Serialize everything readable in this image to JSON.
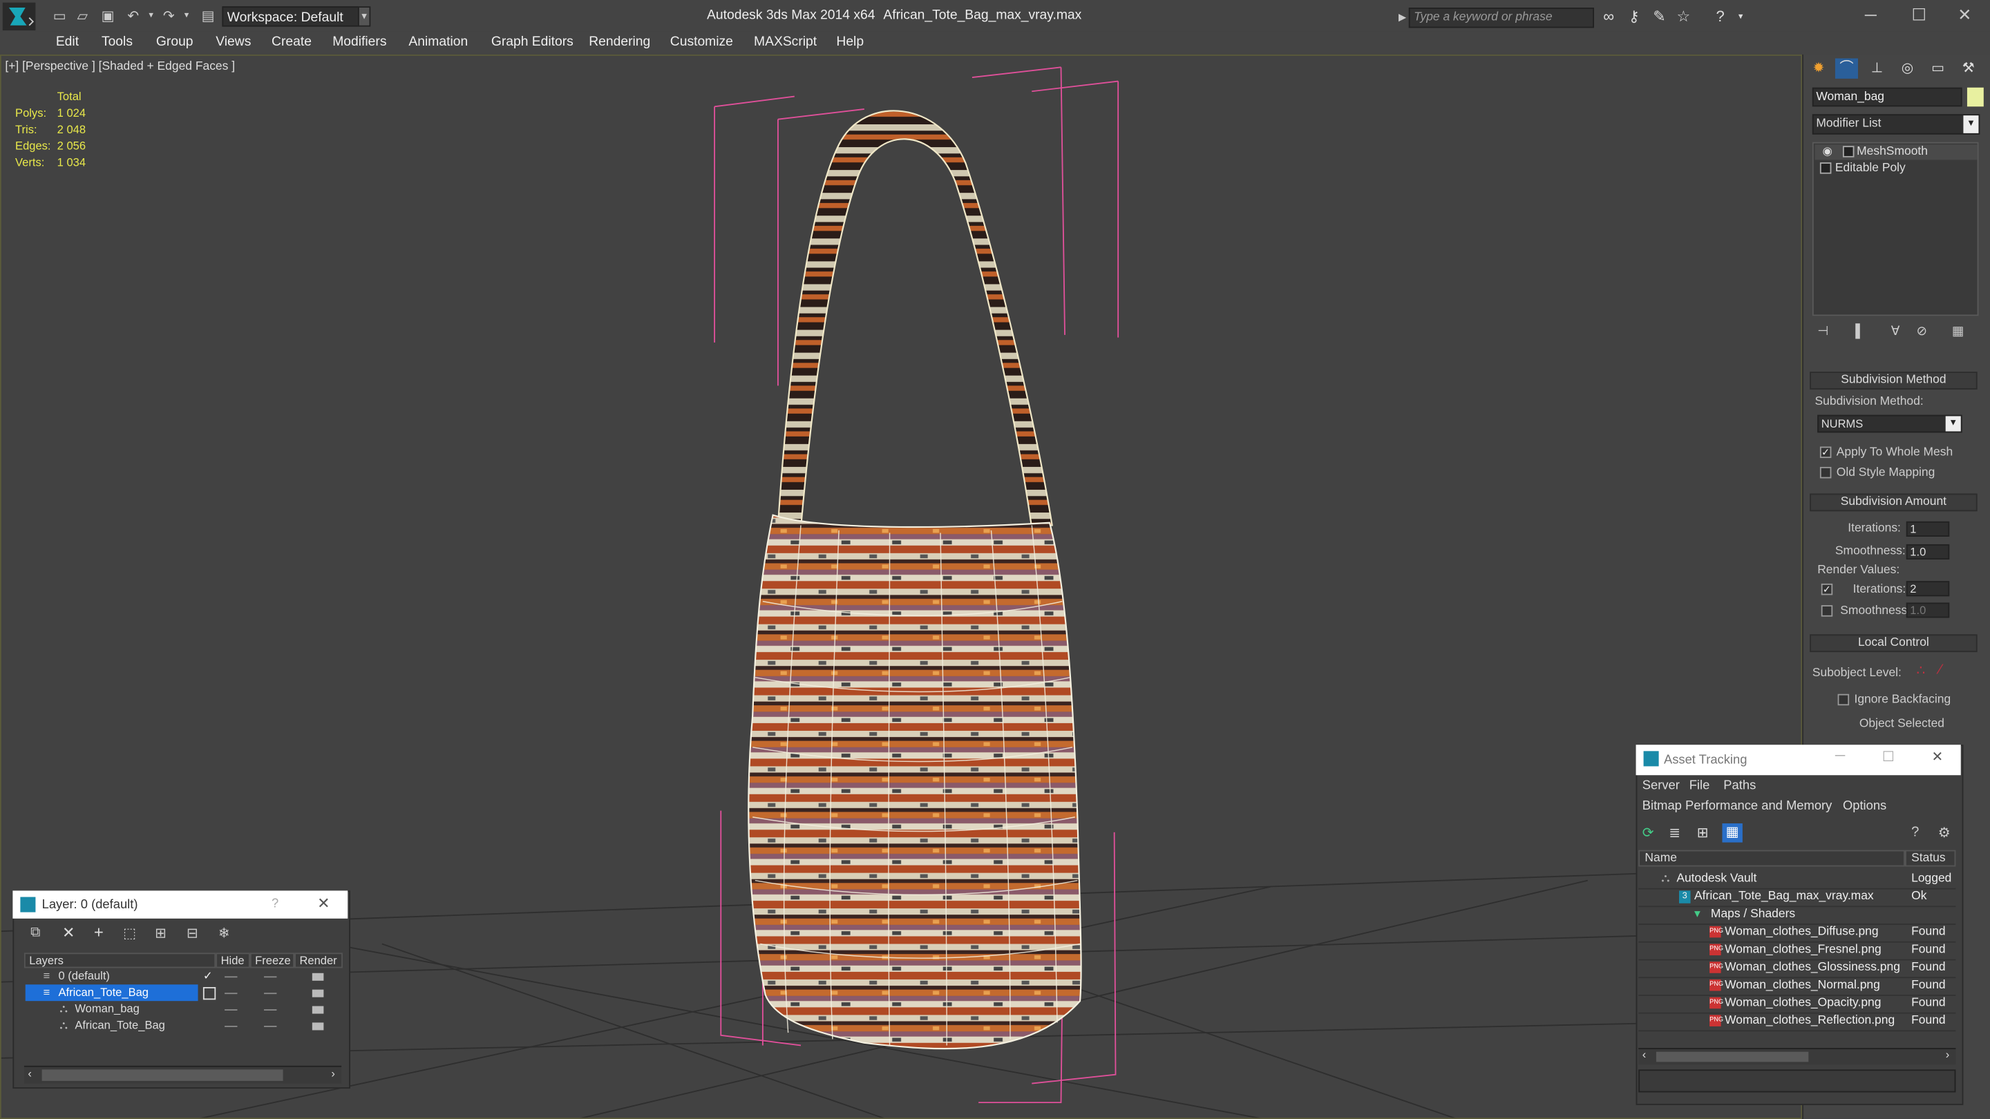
{
  "window": {
    "app_title": "Autodesk 3ds Max  2014 x64",
    "file_title": "African_Tote_Bag_max_vray.max",
    "workspace": "Workspace: Default",
    "search_placeholder": "Type a keyword or phrase"
  },
  "menu": [
    "Edit",
    "Tools",
    "Group",
    "Views",
    "Create",
    "Modifiers",
    "Animation",
    "Graph Editors",
    "Rendering",
    "Customize",
    "MAXScript",
    "Help"
  ],
  "viewport": {
    "label": "[+] [Perspective ] [Shaded + Edged Faces ]",
    "stats_header": "Total",
    "stats": [
      {
        "label": "Polys:",
        "value": "1 024"
      },
      {
        "label": "Tris:",
        "value": "2 048"
      },
      {
        "label": "Edges:",
        "value": "2 056"
      },
      {
        "label": "Verts:",
        "value": "1 034"
      }
    ]
  },
  "command_panel": {
    "object_name": "Woman_bag",
    "modifier_list": "Modifier List",
    "stack": [
      "MeshSmooth",
      "Editable Poly"
    ],
    "subdivision_method_header": "Subdivision Method",
    "subdivision_method_label": "Subdivision Method:",
    "subdivision_method_value": "NURMS",
    "apply_whole_mesh": "Apply To Whole Mesh",
    "old_style_mapping": "Old Style Mapping",
    "subdivision_amount_header": "Subdivision Amount",
    "iterations_label": "Iterations:",
    "iterations_value": "1",
    "smoothness_label": "Smoothness:",
    "smoothness_value": "1.0",
    "render_values_label": "Render Values:",
    "render_iterations_label": "Iterations:",
    "render_iterations_value": "2",
    "render_smoothness_label": "Smoothness:",
    "render_smoothness_value": "1.0",
    "local_control_header": "Local Control",
    "subobject_level_label": "Subobject Level:",
    "ignore_backfacing": "Ignore Backfacing",
    "object_selected": "Object Selected"
  },
  "layer_dialog": {
    "title": "Layer: 0 (default)",
    "help": "?",
    "columns": [
      "Layers",
      "Hide",
      "Freeze",
      "Render"
    ],
    "rows": [
      {
        "name": "0 (default)"
      },
      {
        "name": "African_Tote_Bag"
      },
      {
        "name": "Woman_bag"
      },
      {
        "name": "African_Tote_Bag"
      }
    ]
  },
  "asset_tracking": {
    "title": "Asset Tracking",
    "menus_row1": [
      "Server",
      "File",
      "Paths"
    ],
    "menus_row2": [
      "Bitmap Performance and Memory",
      "Options"
    ],
    "columns": [
      "Name",
      "Status"
    ],
    "rows": [
      {
        "name": "Autodesk Vault",
        "status": "Logged"
      },
      {
        "name": "African_Tote_Bag_max_vray.max",
        "status": "Ok"
      },
      {
        "name": "Maps / Shaders",
        "status": ""
      },
      {
        "name": "Woman_clothes_Diffuse.png",
        "status": "Found"
      },
      {
        "name": "Woman_clothes_Fresnel.png",
        "status": "Found"
      },
      {
        "name": "Woman_clothes_Glossiness.png",
        "status": "Found"
      },
      {
        "name": "Woman_clothes_Normal.png",
        "status": "Found"
      },
      {
        "name": "Woman_clothes_Opacity.png",
        "status": "Found"
      },
      {
        "name": "Woman_clothes_Reflection.png",
        "status": "Found"
      }
    ]
  },
  "colors": {
    "viewport_bg": "#424242",
    "stats_text": "#e8e84a",
    "selection_blue": "#1e6fd8",
    "bbox_pink": "#e0509a",
    "object_color": "#e8f0a0"
  }
}
